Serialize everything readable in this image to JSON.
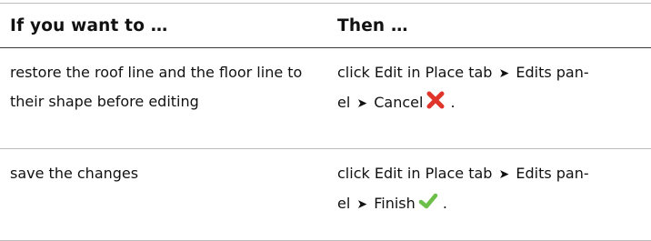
{
  "table": {
    "headers": {
      "condition": "If you want to …",
      "action": "Then …"
    },
    "rows": [
      {
        "condition": "restore the roof line and the floor line to their shape before editing",
        "action": {
          "part1": "click Edit in Place tab",
          "arrow1": "➤",
          "part2": "Edits pan-",
          "part3": "el",
          "arrow2": "➤",
          "part4": "Cancel",
          "end": ".",
          "icon": "cancel-x-icon",
          "icon_color": "#e0352b"
        }
      },
      {
        "condition": "save the changes",
        "action": {
          "part1": "click Edit in Place tab",
          "arrow1": "➤",
          "part2": "Edits pan-",
          "part3": "el",
          "arrow2": "➤",
          "part4": "Finish",
          "end": ".",
          "icon": "finish-checkmark-icon",
          "icon_color": "#6cc04a"
        }
      }
    ]
  }
}
